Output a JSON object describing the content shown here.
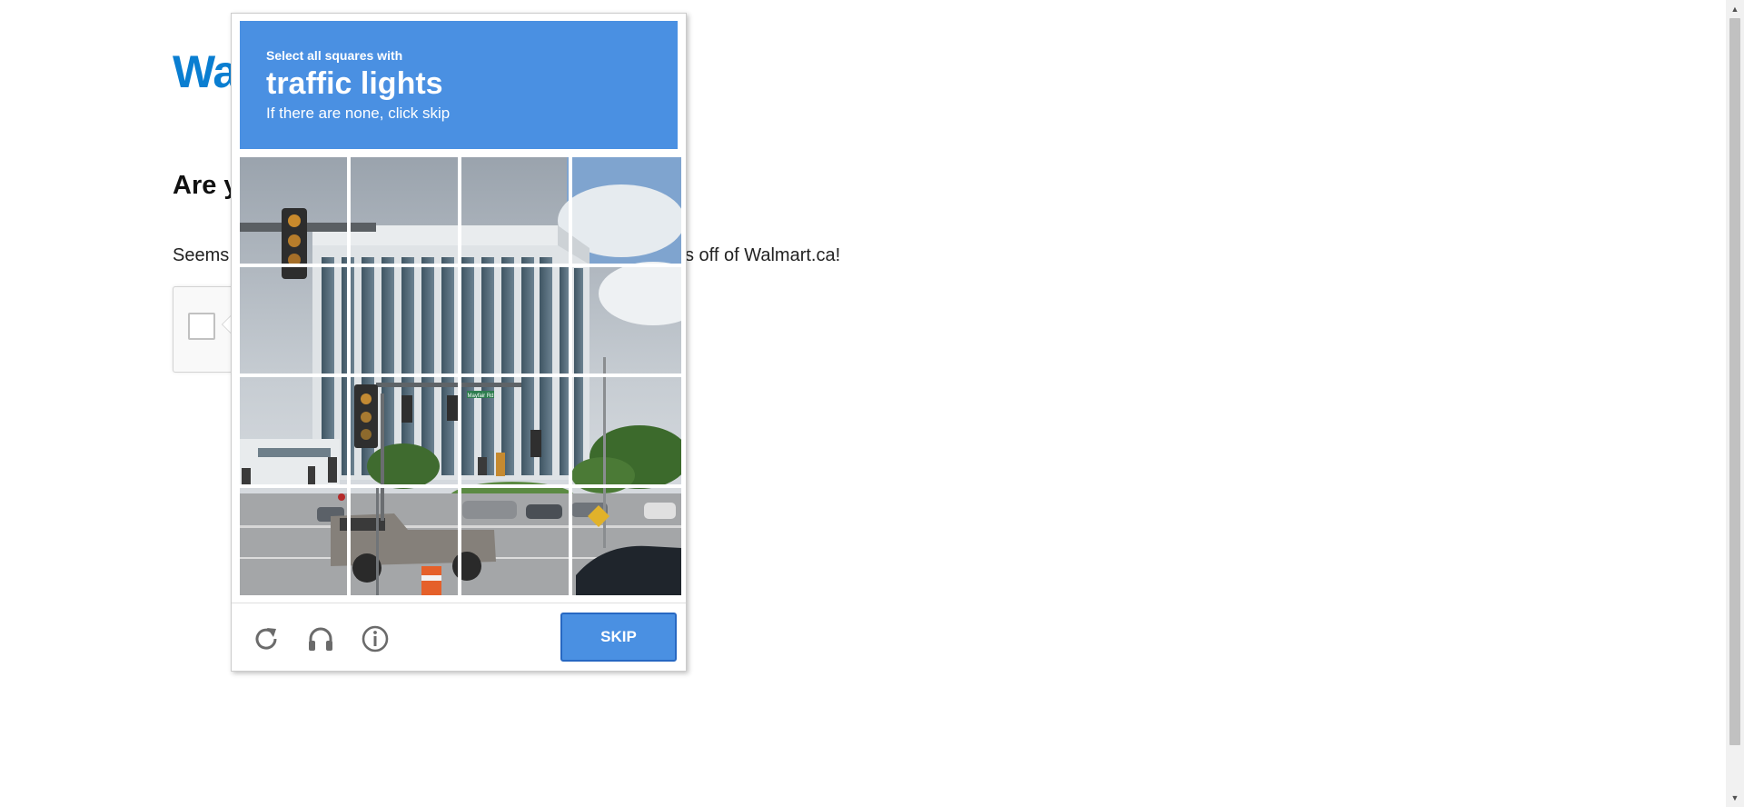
{
  "page": {
    "logo_text": "Wa",
    "heading": "Are y",
    "message_start": "Seems",
    "message_end": "s off of Walmart.ca!"
  },
  "captcha": {
    "instruction_line1": "Select all squares with",
    "target_object": "traffic lights",
    "instruction_line3": "If there are none, click skip",
    "tiles": [
      "r1c1",
      "r1c2",
      "r1c3",
      "r1c4",
      "r2c1",
      "r2c2",
      "r2c3",
      "r2c4",
      "r3c1",
      "r3c2",
      "r3c3",
      "r3c4",
      "r4c1",
      "r4c2",
      "r4c3",
      "r4c4"
    ],
    "street_sign_text": "Mayfair Rd",
    "footer": {
      "reload_icon": "reload-icon",
      "audio_icon": "headphones-icon",
      "info_icon": "info-icon",
      "skip_label": "SKIP"
    },
    "colors": {
      "header_bg": "#4a90e2",
      "skip_border": "#2768c2"
    }
  },
  "scrollbar": {
    "up_icon": "▲",
    "down_icon": "▼"
  }
}
